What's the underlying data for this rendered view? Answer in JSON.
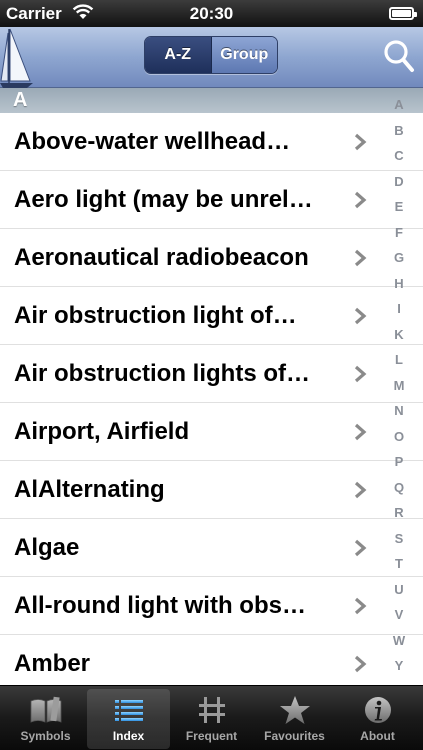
{
  "status_bar": {
    "carrier": "Carrier",
    "time": "20:30"
  },
  "nav": {
    "segments": [
      {
        "label": "A-Z",
        "active": true
      },
      {
        "label": "Group",
        "active": false
      }
    ],
    "search_icon": "search-icon"
  },
  "section": {
    "header": "A"
  },
  "list": {
    "items": [
      "Above-water wellhead…",
      "Aero light (may be unrel…",
      "Aeronautical radiobeacon",
      "Air obstruction light of…",
      "Air obstruction lights of…",
      "Airport, Airfield",
      "AlAlternating",
      "Algae",
      "All-round light with obs…",
      "Amber"
    ]
  },
  "index": [
    "A",
    "B",
    "C",
    "D",
    "E",
    "F",
    "G",
    "H",
    "I",
    "K",
    "L",
    "M",
    "N",
    "O",
    "P",
    "Q",
    "R",
    "S",
    "T",
    "U",
    "V",
    "W",
    "Y"
  ],
  "tabs": [
    {
      "label": "Symbols",
      "icon": "book-icon",
      "selected": false
    },
    {
      "label": "Index",
      "icon": "list-icon",
      "selected": true
    },
    {
      "label": "Frequent",
      "icon": "crosshair-icon",
      "selected": false
    },
    {
      "label": "Favourites",
      "icon": "star-icon",
      "selected": false
    },
    {
      "label": "About",
      "icon": "info-icon",
      "selected": false
    }
  ],
  "colors": {
    "nav_gradient_top": "#b7c8e4",
    "nav_gradient_bottom": "#7189bd",
    "chevron": "#8a8a8a"
  }
}
